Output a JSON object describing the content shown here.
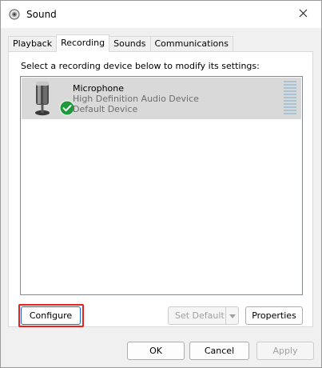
{
  "window": {
    "title": "Sound",
    "close_icon": "close-icon",
    "app_icon": "speaker-icon"
  },
  "tabs": [
    {
      "label": "Playback",
      "active": false
    },
    {
      "label": "Recording",
      "active": true
    },
    {
      "label": "Sounds",
      "active": false
    },
    {
      "label": "Communications",
      "active": false
    }
  ],
  "recording": {
    "instruction": "Select a recording device below to modify its settings:",
    "devices": [
      {
        "name": "Microphone",
        "description": "High Definition Audio Device",
        "state": "Default Device",
        "icon": "microphone-icon",
        "badge": "check-badge-icon",
        "badge_color": "#1e9a3d",
        "level": 0
      }
    ],
    "buttons": {
      "configure": "Configure",
      "set_default": "Set Default",
      "properties": "Properties"
    }
  },
  "footer": {
    "ok": "OK",
    "cancel": "Cancel",
    "apply": "Apply"
  },
  "colors": {
    "selection_bg": "#d9d9d9",
    "highlight_border": "#e8211f",
    "focus_border": "#1a6ed3"
  }
}
